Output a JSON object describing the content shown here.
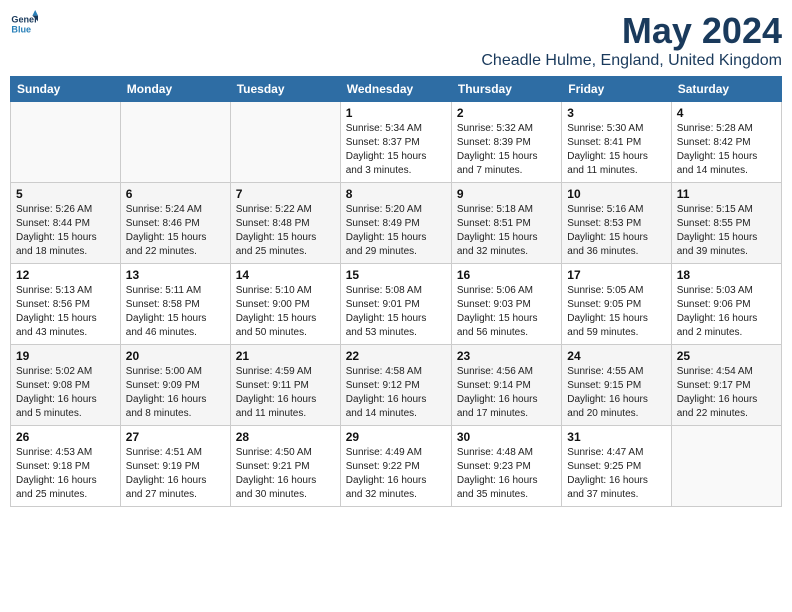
{
  "logo": {
    "line1": "General",
    "line2": "Blue"
  },
  "title": "May 2024",
  "location": "Cheadle Hulme, England, United Kingdom",
  "weekdays": [
    "Sunday",
    "Monday",
    "Tuesday",
    "Wednesday",
    "Thursday",
    "Friday",
    "Saturday"
  ],
  "weeks": [
    [
      {
        "day": "",
        "info": ""
      },
      {
        "day": "",
        "info": ""
      },
      {
        "day": "",
        "info": ""
      },
      {
        "day": "1",
        "info": "Sunrise: 5:34 AM\nSunset: 8:37 PM\nDaylight: 15 hours\nand 3 minutes."
      },
      {
        "day": "2",
        "info": "Sunrise: 5:32 AM\nSunset: 8:39 PM\nDaylight: 15 hours\nand 7 minutes."
      },
      {
        "day": "3",
        "info": "Sunrise: 5:30 AM\nSunset: 8:41 PM\nDaylight: 15 hours\nand 11 minutes."
      },
      {
        "day": "4",
        "info": "Sunrise: 5:28 AM\nSunset: 8:42 PM\nDaylight: 15 hours\nand 14 minutes."
      }
    ],
    [
      {
        "day": "5",
        "info": "Sunrise: 5:26 AM\nSunset: 8:44 PM\nDaylight: 15 hours\nand 18 minutes."
      },
      {
        "day": "6",
        "info": "Sunrise: 5:24 AM\nSunset: 8:46 PM\nDaylight: 15 hours\nand 22 minutes."
      },
      {
        "day": "7",
        "info": "Sunrise: 5:22 AM\nSunset: 8:48 PM\nDaylight: 15 hours\nand 25 minutes."
      },
      {
        "day": "8",
        "info": "Sunrise: 5:20 AM\nSunset: 8:49 PM\nDaylight: 15 hours\nand 29 minutes."
      },
      {
        "day": "9",
        "info": "Sunrise: 5:18 AM\nSunset: 8:51 PM\nDaylight: 15 hours\nand 32 minutes."
      },
      {
        "day": "10",
        "info": "Sunrise: 5:16 AM\nSunset: 8:53 PM\nDaylight: 15 hours\nand 36 minutes."
      },
      {
        "day": "11",
        "info": "Sunrise: 5:15 AM\nSunset: 8:55 PM\nDaylight: 15 hours\nand 39 minutes."
      }
    ],
    [
      {
        "day": "12",
        "info": "Sunrise: 5:13 AM\nSunset: 8:56 PM\nDaylight: 15 hours\nand 43 minutes."
      },
      {
        "day": "13",
        "info": "Sunrise: 5:11 AM\nSunset: 8:58 PM\nDaylight: 15 hours\nand 46 minutes."
      },
      {
        "day": "14",
        "info": "Sunrise: 5:10 AM\nSunset: 9:00 PM\nDaylight: 15 hours\nand 50 minutes."
      },
      {
        "day": "15",
        "info": "Sunrise: 5:08 AM\nSunset: 9:01 PM\nDaylight: 15 hours\nand 53 minutes."
      },
      {
        "day": "16",
        "info": "Sunrise: 5:06 AM\nSunset: 9:03 PM\nDaylight: 15 hours\nand 56 minutes."
      },
      {
        "day": "17",
        "info": "Sunrise: 5:05 AM\nSunset: 9:05 PM\nDaylight: 15 hours\nand 59 minutes."
      },
      {
        "day": "18",
        "info": "Sunrise: 5:03 AM\nSunset: 9:06 PM\nDaylight: 16 hours\nand 2 minutes."
      }
    ],
    [
      {
        "day": "19",
        "info": "Sunrise: 5:02 AM\nSunset: 9:08 PM\nDaylight: 16 hours\nand 5 minutes."
      },
      {
        "day": "20",
        "info": "Sunrise: 5:00 AM\nSunset: 9:09 PM\nDaylight: 16 hours\nand 8 minutes."
      },
      {
        "day": "21",
        "info": "Sunrise: 4:59 AM\nSunset: 9:11 PM\nDaylight: 16 hours\nand 11 minutes."
      },
      {
        "day": "22",
        "info": "Sunrise: 4:58 AM\nSunset: 9:12 PM\nDaylight: 16 hours\nand 14 minutes."
      },
      {
        "day": "23",
        "info": "Sunrise: 4:56 AM\nSunset: 9:14 PM\nDaylight: 16 hours\nand 17 minutes."
      },
      {
        "day": "24",
        "info": "Sunrise: 4:55 AM\nSunset: 9:15 PM\nDaylight: 16 hours\nand 20 minutes."
      },
      {
        "day": "25",
        "info": "Sunrise: 4:54 AM\nSunset: 9:17 PM\nDaylight: 16 hours\nand 22 minutes."
      }
    ],
    [
      {
        "day": "26",
        "info": "Sunrise: 4:53 AM\nSunset: 9:18 PM\nDaylight: 16 hours\nand 25 minutes."
      },
      {
        "day": "27",
        "info": "Sunrise: 4:51 AM\nSunset: 9:19 PM\nDaylight: 16 hours\nand 27 minutes."
      },
      {
        "day": "28",
        "info": "Sunrise: 4:50 AM\nSunset: 9:21 PM\nDaylight: 16 hours\nand 30 minutes."
      },
      {
        "day": "29",
        "info": "Sunrise: 4:49 AM\nSunset: 9:22 PM\nDaylight: 16 hours\nand 32 minutes."
      },
      {
        "day": "30",
        "info": "Sunrise: 4:48 AM\nSunset: 9:23 PM\nDaylight: 16 hours\nand 35 minutes."
      },
      {
        "day": "31",
        "info": "Sunrise: 4:47 AM\nSunset: 9:25 PM\nDaylight: 16 hours\nand 37 minutes."
      },
      {
        "day": "",
        "info": ""
      }
    ]
  ]
}
